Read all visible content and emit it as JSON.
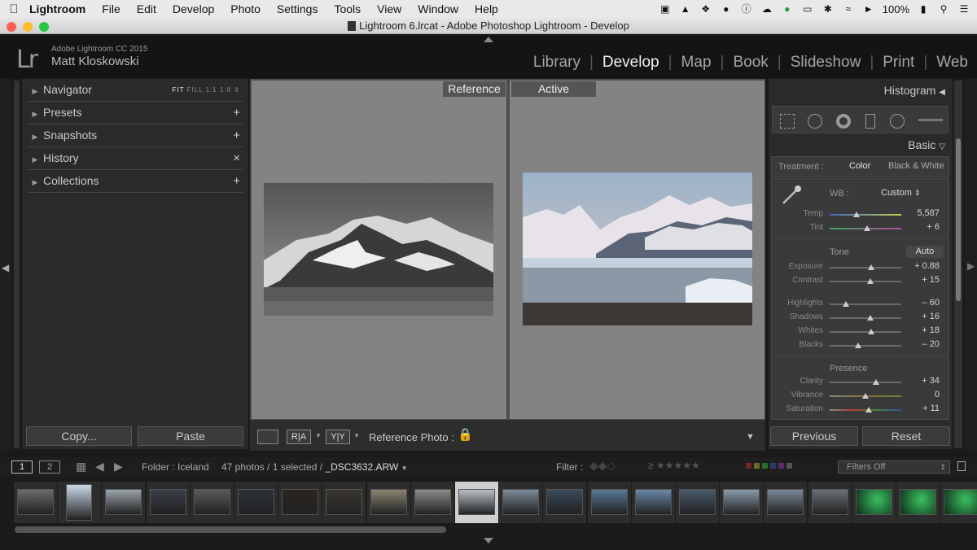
{
  "menubar": {
    "app": "Lightroom",
    "items": [
      "File",
      "Edit",
      "Develop",
      "Photo",
      "Settings",
      "Tools",
      "View",
      "Window",
      "Help"
    ],
    "battery": "100%"
  },
  "titlebar": {
    "title": "Lightroom 6.lrcat - Adobe Photoshop Lightroom - Develop"
  },
  "header": {
    "logo": "Lr",
    "brand": "Adobe Lightroom CC 2015",
    "user": "Matt Kloskowski",
    "modules": [
      "Library",
      "Develop",
      "Map",
      "Book",
      "Slideshow",
      "Print",
      "Web"
    ],
    "active_module": "Develop"
  },
  "left_panel": {
    "navigator": "Navigator",
    "zoom": [
      "FIT",
      "FILL",
      "1:1",
      "1:8"
    ],
    "presets": "Presets",
    "snapshots": "Snapshots",
    "history": "History",
    "collections": "Collections",
    "copy": "Copy...",
    "paste": "Paste"
  },
  "center": {
    "reference_label": "Reference",
    "active_label": "Active",
    "toolbar": {
      "ra": "R|A",
      "yy": "Y|Y",
      "reference_photo": "Reference Photo :"
    }
  },
  "right_panel": {
    "histogram": "Histogram",
    "basic": "Basic",
    "treatment_label": "Treatment :",
    "treatment_color": "Color",
    "treatment_bw": "Black & White",
    "wb_label": "WB :",
    "wb_value": "Custom",
    "tone": "Tone",
    "auto": "Auto",
    "presence": "Presence",
    "sliders": [
      {
        "label": "Temp",
        "value": "5,587",
        "pos": 0.38
      },
      {
        "label": "Tint",
        "value": "+ 6",
        "pos": 0.52
      },
      {
        "label": "Exposure",
        "value": "+ 0.88",
        "pos": 0.58
      },
      {
        "label": "Contrast",
        "value": "+ 15",
        "pos": 0.57
      },
      {
        "label": "Highlights",
        "value": "– 60",
        "pos": 0.23
      },
      {
        "label": "Shadows",
        "value": "+ 16",
        "pos": 0.57
      },
      {
        "label": "Whites",
        "value": "+ 18",
        "pos": 0.58
      },
      {
        "label": "Blacks",
        "value": "– 20",
        "pos": 0.4
      },
      {
        "label": "Clarity",
        "value": "+ 34",
        "pos": 0.65
      },
      {
        "label": "Vibrance",
        "value": "0",
        "pos": 0.5
      },
      {
        "label": "Saturation",
        "value": "+ 11",
        "pos": 0.55
      }
    ],
    "previous": "Previous",
    "reset": "Reset"
  },
  "filmstrip": {
    "page1": "1",
    "page2": "2",
    "folder": "Folder : Iceland",
    "count": "47 photos / 1 selected /",
    "filename": "_DSC3632.ARW",
    "filter_label": "Filter :",
    "filter_select": "Filters Off"
  },
  "colors": {
    "accent": "#e8e8e8",
    "panel": "#2a2a2a",
    "selected_thumb": "#cfcfcf"
  }
}
